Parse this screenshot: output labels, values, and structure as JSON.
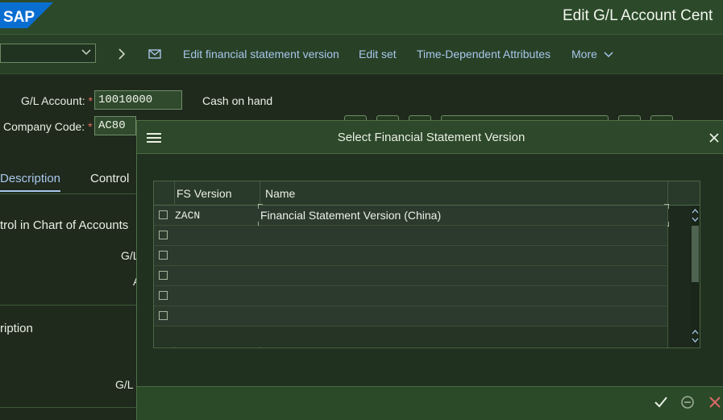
{
  "header": {
    "logo_text": "SAP",
    "title": "Edit G/L Account Cent"
  },
  "toolbar": {
    "links": [
      "Edit financial statement version",
      "Edit set",
      "Time-Dependent Attributes",
      "More"
    ]
  },
  "form": {
    "gl_account_label": "G/L Account:",
    "gl_account_value": "10010000",
    "gl_account_description": "Cash on hand",
    "company_code_label": "Company Code:",
    "company_code_value": "AC80",
    "required_marker": "*"
  },
  "tabs": [
    "Description",
    "Control"
  ],
  "background_text": {
    "section1": "trol in Chart of Accounts",
    "gl_fragment1": "G/L",
    "a_fragment": "A",
    "section2": "ription",
    "gl_fragment2": "G/L"
  },
  "dialog": {
    "title": "Select Financial Statement Version",
    "columns": [
      "FS Version",
      "Name"
    ],
    "rows": [
      {
        "code": "ZACN",
        "name": "Financial Statement Version (China)"
      },
      {
        "code": "",
        "name": ""
      },
      {
        "code": "",
        "name": ""
      },
      {
        "code": "",
        "name": ""
      },
      {
        "code": "",
        "name": ""
      },
      {
        "code": "",
        "name": ""
      }
    ]
  },
  "colors": {
    "link": "#a9c6ec",
    "required": "#e46f5c",
    "confirm": "#e9efe4",
    "cancel": "#e06a6a"
  },
  "icons": [
    "chevron-down-icon",
    "chevron-right-icon",
    "envelope-icon",
    "menu-icon",
    "close-icon",
    "checkmark-icon",
    "minus-circle-icon",
    "cancel-x-icon",
    "scroll-up-icon",
    "scroll-down-icon"
  ]
}
